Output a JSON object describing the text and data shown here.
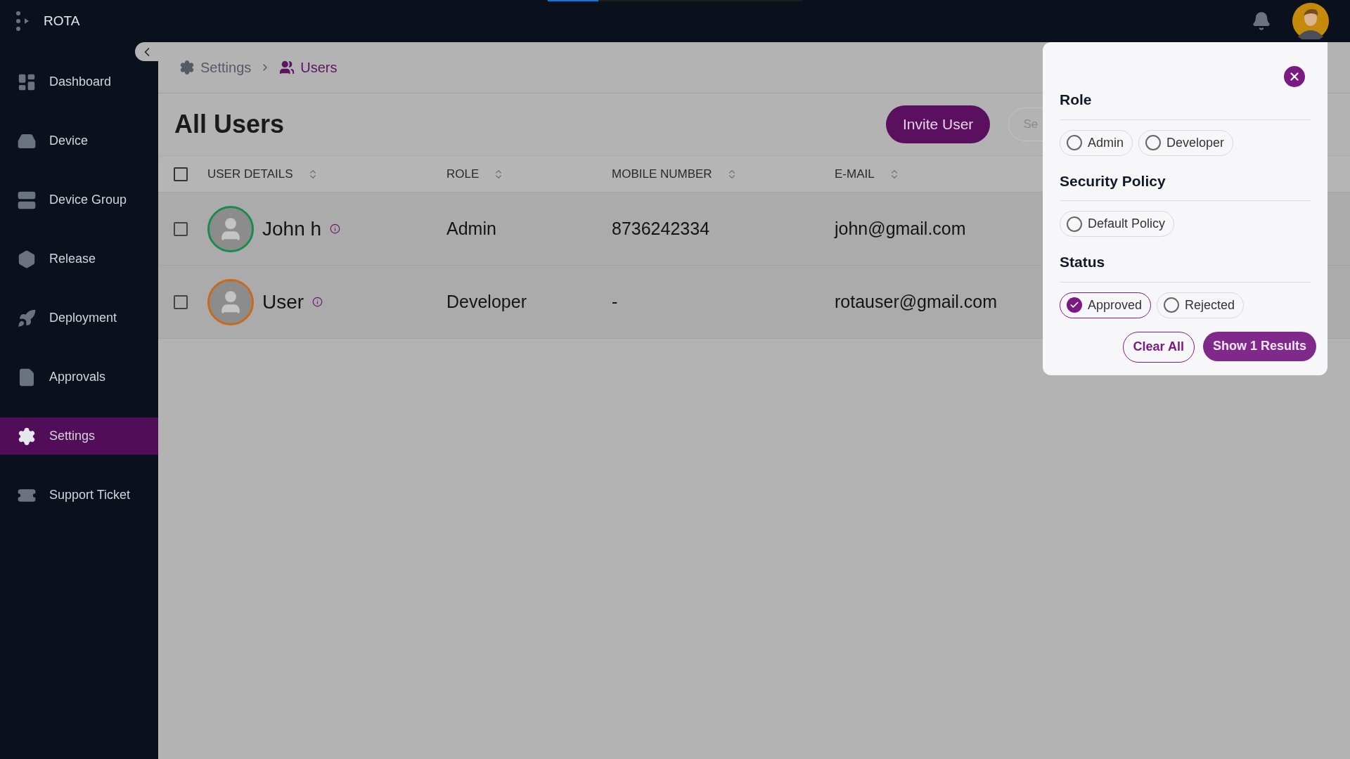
{
  "top_progress": {
    "level": 0.2
  },
  "brand": {
    "name": "ROTA"
  },
  "sidebar": {
    "items": [
      {
        "label": "Dashboard",
        "selected": false
      },
      {
        "label": "Device",
        "selected": false
      },
      {
        "label": "Device Group",
        "selected": false
      },
      {
        "label": "Release",
        "selected": false
      },
      {
        "label": "Deployment",
        "selected": false
      },
      {
        "label": "Approvals",
        "selected": false
      },
      {
        "label": "Settings",
        "selected": true
      },
      {
        "label": "Support Ticket",
        "selected": false
      }
    ]
  },
  "breadcrumb": [
    {
      "label": "Settings",
      "current": false
    },
    {
      "label": "Users",
      "current": true
    }
  ],
  "page_title": "All Users",
  "invite_button": "Invite User",
  "search": {
    "placeholder": "Se"
  },
  "table": {
    "header_checked": false,
    "columns": [
      "USER DETAILS",
      "ROLE",
      "MOBILE NUMBER",
      "E-MAIL"
    ],
    "rows": [
      {
        "name": "John h",
        "role": "Admin",
        "mobile": "8736242334",
        "email": "john@gmail.com",
        "checked": false,
        "color": "#1a8a4f"
      },
      {
        "name": "User",
        "role": "Developer",
        "mobile": "-",
        "email": "rotauser@gmail.com",
        "checked": false,
        "color": "#c8691c"
      }
    ]
  },
  "filter": {
    "sections": [
      {
        "title": "Role",
        "options": [
          {
            "label": "Admin",
            "selected": false
          },
          {
            "label": "Developer",
            "selected": false
          }
        ]
      },
      {
        "title": "Security Policy",
        "options": [
          {
            "label": "Default Policy",
            "selected": false
          }
        ]
      },
      {
        "title": "Status",
        "options": [
          {
            "label": "Approved",
            "selected": true
          },
          {
            "label": "Rejected",
            "selected": false
          }
        ]
      }
    ],
    "clear_button": "Clear All",
    "apply_button": "Show 1 Results"
  }
}
